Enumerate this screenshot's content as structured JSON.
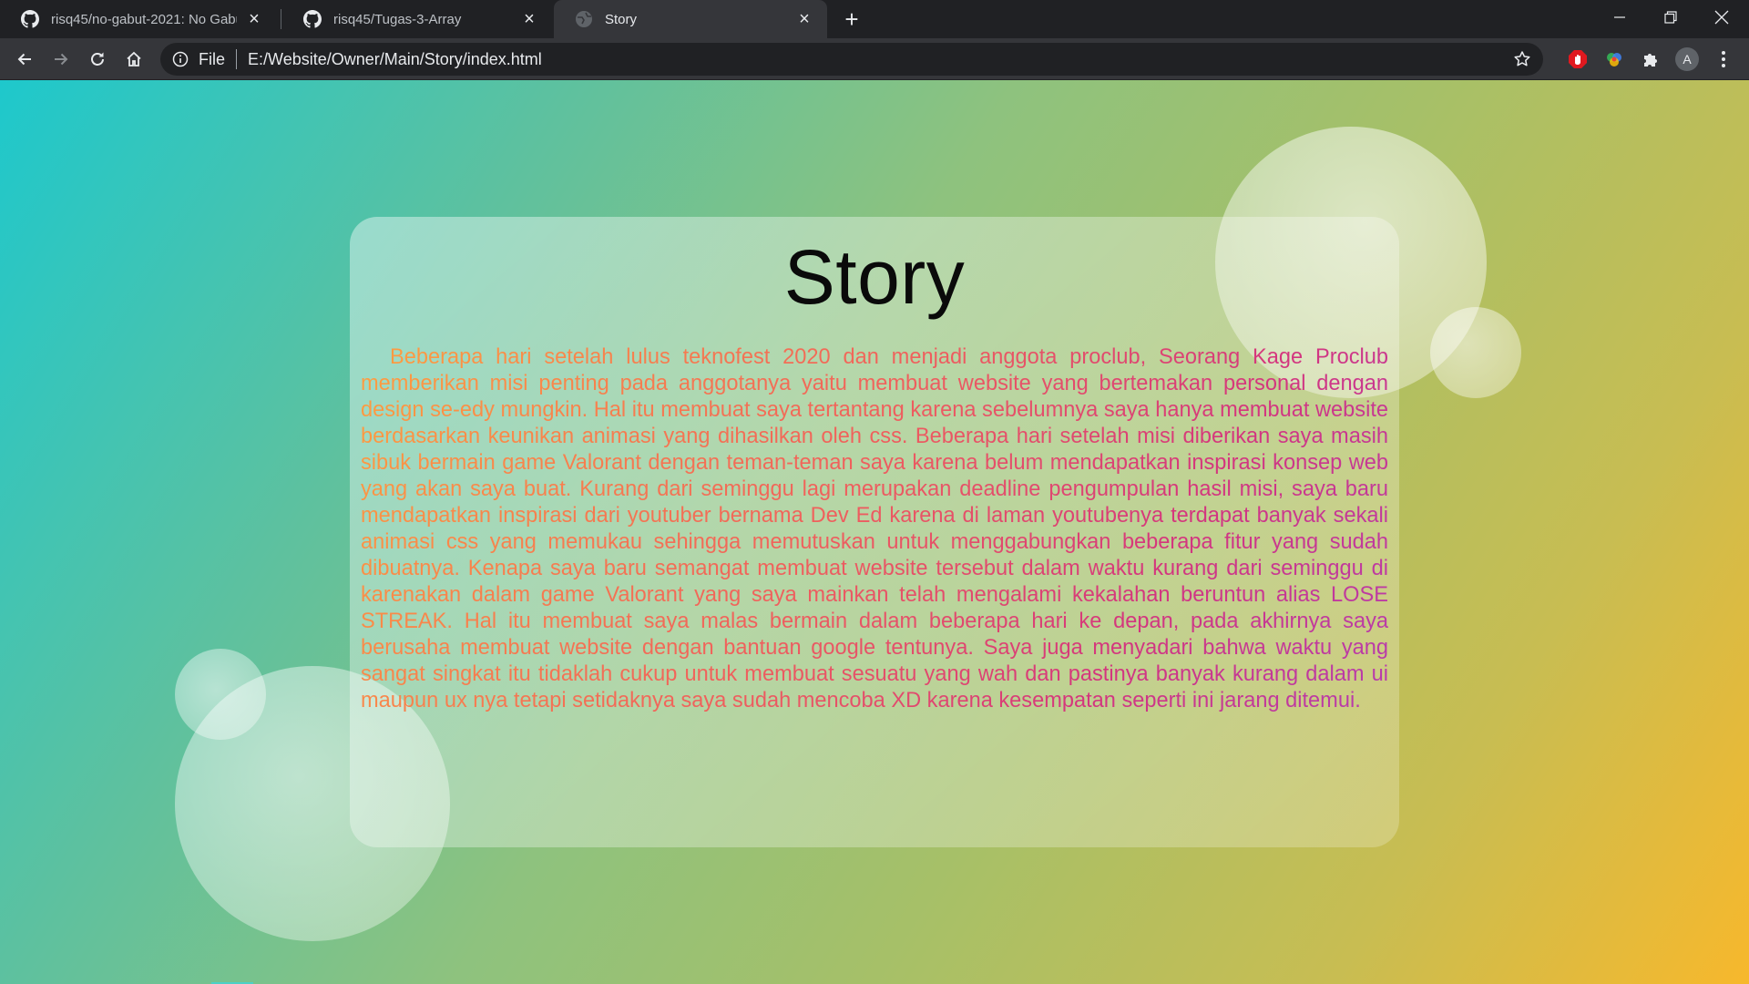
{
  "browser": {
    "tabs": [
      {
        "title": "risq45/no-gabut-2021: No Gabut",
        "icon": "github-icon"
      },
      {
        "title": "risq45/Tugas-3-Array",
        "icon": "github-icon"
      },
      {
        "title": "Story",
        "icon": "globe-icon"
      }
    ],
    "new_tab": "+",
    "address": {
      "scheme": "File",
      "url": "E:/Website/Owner/Main/Story/index.html"
    },
    "profile_initial": "A"
  },
  "page": {
    "title": "Story",
    "paragraph": "Beberapa hari setelah lulus teknofest 2020 dan menjadi anggota proclub, Seorang Kage Proclub memberikan misi penting pada anggotanya yaitu membuat website yang bertemakan personal dengan design se-edy mungkin. Hal itu membuat saya tertantang karena sebelumnya saya hanya membuat website berdasarkan keunikan animasi yang dihasilkan oleh css. Beberapa hari setelah misi diberikan saya masih sibuk bermain game Valorant dengan teman-teman saya karena belum mendapatkan inspirasi konsep web yang akan saya buat. Kurang dari seminggu lagi merupakan deadline pengumpulan hasil misi, saya baru mendapatkan inspirasi dari youtuber bernama Dev Ed karena di laman youtubenya terdapat banyak sekali animasi css yang memukau sehingga memutuskan untuk menggabungkan beberapa fitur yang sudah dibuatnya. Kenapa saya baru semangat membuat website tersebut dalam waktu kurang dari seminggu di karenakan dalam game Valorant yang saya mainkan telah mengalami kekalahan beruntun alias LOSE STREAK. Hal itu membuat saya malas bermain dalam beberapa hari ke depan, pada akhirnya saya berusaha membuat website dengan bantuan google tentunya. Saya juga menyadari bahwa waktu yang sangat singkat itu tidaklah cukup untuk membuat sesuatu yang wah dan pastinya banyak kurang dalam ui maupun ux nya tetapi setidaknya saya sudah mencoba XD karena kesempatan seperti ini jarang ditemui."
  },
  "colors": {
    "bg_gradient": [
      "#1ec8cc",
      "#8ec27e",
      "#f7b82c"
    ],
    "text_gradient": [
      "#ff9f3f",
      "#f0605c",
      "#d4357e",
      "#b53bb0"
    ]
  }
}
